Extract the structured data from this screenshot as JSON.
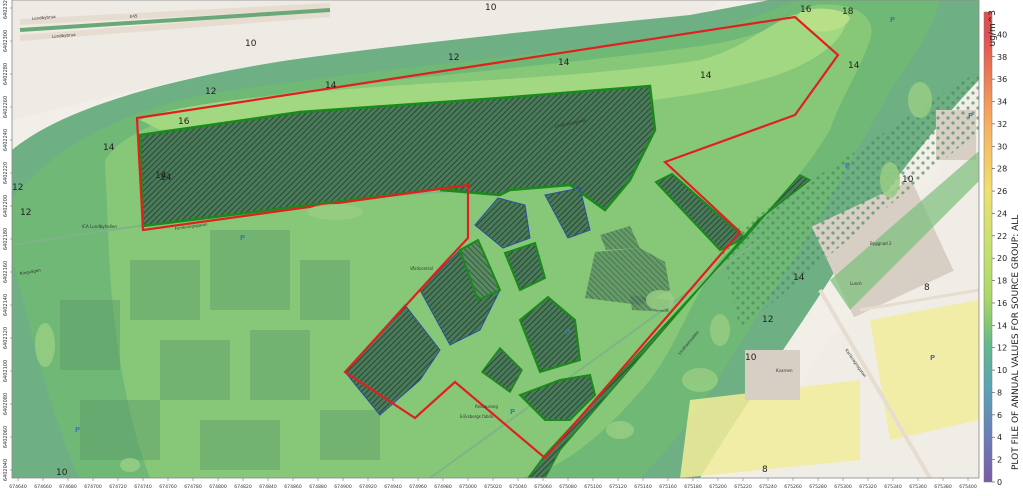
{
  "map": {
    "street_labels": [
      {
        "id": "lundbybrua-1",
        "text": "Lundbybrua"
      },
      {
        "id": "lundbybrua-2",
        "text": "Lundbybrua"
      },
      {
        "id": "e45",
        "text": "E45"
      },
      {
        "id": "ringvagen",
        "text": "Ringvägen"
      },
      {
        "id": "lindholmsallen",
        "text": "Lindholmsallén"
      },
      {
        "id": "forskningsgatan",
        "text": "Forskningsgatan"
      },
      {
        "id": "karlavagnsgatan",
        "text": "Karlavagnsgatan"
      },
      {
        "id": "lindholmsgatan",
        "text": "Lindholmsgatan"
      }
    ],
    "poi_labels": [
      {
        "id": "ica",
        "text": "ICA Lundbyhallen"
      },
      {
        "id": "bygg",
        "text": "Byggnad 2"
      },
      {
        "id": "kvarnen",
        "text": "Kvarnen"
      },
      {
        "id": "vardcentral",
        "text": "Vårdcentral"
      },
      {
        "id": "lunch",
        "text": "Lunch"
      },
      {
        "id": "restaurang",
        "text": "Restaurang"
      },
      {
        "id": "eriksberg",
        "text": "Eriksbergs\nfabrik"
      }
    ],
    "contour_labels": [
      "10",
      "10",
      "12",
      "12",
      "12",
      "14",
      "14",
      "14",
      "14",
      "14",
      "16",
      "16",
      "18",
      "14",
      "14",
      "12",
      "10",
      "10",
      "8",
      "8",
      "10",
      "12",
      "14"
    ],
    "parking_symbol": "P",
    "y_ticks": [
      "6402320",
      "6402300",
      "6402280",
      "6402260",
      "6402240",
      "6402220",
      "6402200",
      "6402180",
      "6402160",
      "6402140",
      "6402120",
      "6402100",
      "6402080",
      "6402060",
      "6402040"
    ],
    "x_ticks": [
      "674640",
      "674660",
      "674680",
      "674700",
      "674720",
      "674740",
      "674760",
      "674780",
      "674800",
      "674820",
      "674840",
      "674860",
      "674880",
      "674900",
      "674920",
      "674940",
      "674960",
      "674980",
      "675000",
      "675020",
      "675040",
      "675060",
      "675080",
      "675100",
      "675120",
      "675140",
      "675160",
      "675180",
      "675200",
      "675220",
      "675240",
      "675260",
      "675280",
      "675300",
      "675320",
      "675340",
      "675360",
      "675380",
      "675400"
    ]
  },
  "legend": {
    "unit": "ug/m^3",
    "title": "PLOT FILE OF ANNUAL VALUES FOR SOURCE GROUP: ALL",
    "min": 0,
    "max": 42,
    "ticks": [
      "0",
      "2",
      "4",
      "6",
      "8",
      "10",
      "12",
      "14",
      "16",
      "18",
      "20",
      "22",
      "24",
      "26",
      "28",
      "30",
      "32",
      "34",
      "36",
      "38",
      "40"
    ],
    "colors": {
      "c0": "#7b5aa8",
      "c4": "#6a80b8",
      "c8": "#5aa4b4",
      "c12": "#62b890",
      "c14": "#86c870",
      "c16": "#a8d868",
      "c20": "#c0e070",
      "c26": "#f0e070",
      "c32": "#f8b060",
      "c40": "#e05050"
    }
  },
  "colors": {
    "boundary_red": "#e02020",
    "building_green": "#1a8a1a",
    "building_blue": "#2a50a0",
    "zone_10": "#5fa878",
    "zone_12": "#6fb875",
    "zone_14": "#86c877",
    "zone_16": "#a3d882"
  }
}
